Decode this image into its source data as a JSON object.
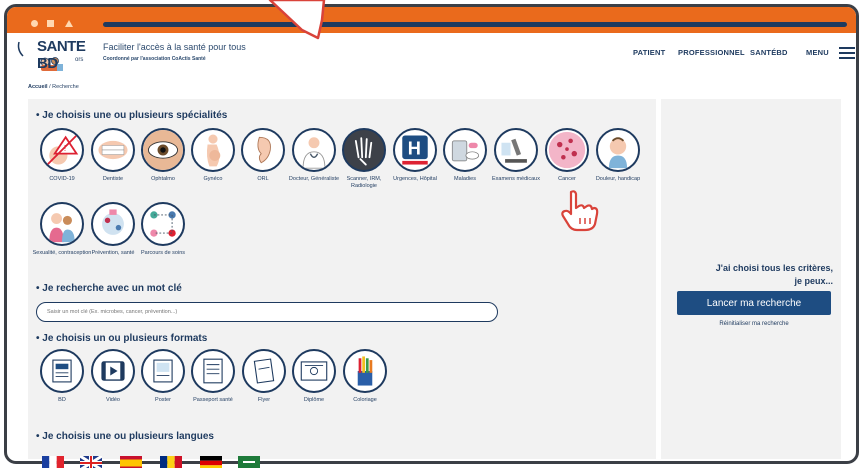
{
  "header": {
    "logo_text": "SANTE BD",
    "logo_sub": "ors",
    "tagline": "Faciliter l'accès à la santé pour tous",
    "tagline_sub": "Coordonné par l'association CoActis Santé",
    "nav": [
      "PATIENT",
      "PROFESSIONNEL",
      "SANTÉBD",
      "MENU"
    ]
  },
  "breadcrumb": {
    "home": "Accueil",
    "current": "/ Recherche"
  },
  "sections": {
    "specialties": "Je choisis une ou plusieurs spécialités",
    "keyword": "Je recherche avec un mot clé",
    "formats": "Je choisis un ou plusieurs formats",
    "languages": "Je choisis une ou plusieurs langues"
  },
  "specialties": [
    {
      "label": "COVID-19",
      "icon": "covid-icon"
    },
    {
      "label": "Dentiste",
      "icon": "teeth-icon"
    },
    {
      "label": "Ophtalmo",
      "icon": "eye-icon"
    },
    {
      "label": "Gynéco",
      "icon": "pregnant-icon"
    },
    {
      "label": "ORL",
      "icon": "ear-icon"
    },
    {
      "label": "Docteur, Généraliste",
      "icon": "doctor-icon"
    },
    {
      "label": "Scanner, IRM, Radiologie",
      "icon": "xray-hand-icon"
    },
    {
      "label": "Urgences, Hôpital",
      "icon": "hospital-icon"
    },
    {
      "label": "Maladies",
      "icon": "pills-icon"
    },
    {
      "label": "Examens médicaux",
      "icon": "microscope-icon"
    },
    {
      "label": "Cancer",
      "icon": "cancer-cell-icon"
    },
    {
      "label": "Douleur, handicap",
      "icon": "child-pain-icon"
    },
    {
      "label": "Sexualité, contraception",
      "icon": "couple-icon"
    },
    {
      "label": "Prévention, santé",
      "icon": "prevention-icon"
    },
    {
      "label": "Parcours de soins",
      "icon": "care-path-icon"
    }
  ],
  "search": {
    "placeholder": "Saisir un mot clé (Ex. microbes, cancer, prévention...)"
  },
  "formats": [
    {
      "label": "BD",
      "icon": "comic-icon"
    },
    {
      "label": "Vidéo",
      "icon": "video-icon"
    },
    {
      "label": "Poster",
      "icon": "poster-icon"
    },
    {
      "label": "Passeport santé",
      "icon": "passport-icon"
    },
    {
      "label": "Flyer",
      "icon": "flyer-icon"
    },
    {
      "label": "Diplôme",
      "icon": "diploma-icon"
    },
    {
      "label": "Coloriage",
      "icon": "pencils-icon"
    }
  ],
  "languages": [
    "france-flag-icon",
    "uk-flag-icon",
    "spain-flag-icon",
    "romania-flag-icon",
    "germany-flag-icon",
    "arabic-flag-icon"
  ],
  "side": {
    "title_line1": "J'ai choisi tous les critères,",
    "title_line2": "je peux...",
    "launch": "Lancer ma recherche",
    "reset": "Réinitialiser ma recherche"
  },
  "colors": {
    "brand": "#1e3a5f",
    "titlebar": "#ea6a1c",
    "button": "#1e4d82",
    "panel": "#f2f2f2"
  }
}
